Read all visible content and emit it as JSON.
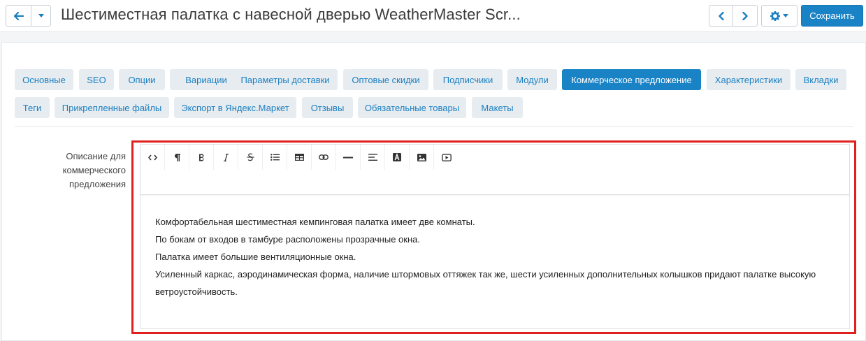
{
  "header": {
    "title": "Шестиместная палатка с навесной дверью WeatherMaster Scr...",
    "save_label": "Сохранить"
  },
  "tabs": [
    {
      "label": "Основные"
    },
    {
      "label": "SEO"
    },
    {
      "label": "Опции"
    },
    {
      "label": "Вариации"
    },
    {
      "label": "Параметры доставки"
    },
    {
      "label": "Оптовые скидки"
    },
    {
      "label": "Подписчики"
    },
    {
      "label": "Модули"
    },
    {
      "label": "Коммерческое предложение",
      "active": true
    },
    {
      "label": "Характеристики"
    },
    {
      "label": "Вкладки"
    },
    {
      "label": "Теги"
    },
    {
      "label": "Прикрепленные файлы"
    },
    {
      "label": "Экспорт в Яндекс.Маркет"
    },
    {
      "label": "Отзывы"
    },
    {
      "label": "Обязательные товары"
    },
    {
      "label": "Макеты"
    }
  ],
  "field": {
    "label": "Описание для коммерческого предложения"
  },
  "toolbar_icons": [
    "code-view-icon",
    "paragraph-icon",
    "bold-icon",
    "italic-icon",
    "strikethrough-icon",
    "unordered-list-icon",
    "table-icon",
    "link-icon",
    "horizontal-rule-icon",
    "align-left-icon",
    "text-color-icon",
    "image-icon",
    "video-icon"
  ],
  "editor": {
    "paragraphs": [
      "Комфортабельная шестиместная кемпинговая палатка имеет две комнаты.",
      "По бокам от входов в тамбуре расположены прозрачные окна.",
      "Палатка имеет большие вентиляционные окна.",
      "Усиленный каркас, аэродинамическая форма, наличие штормовых оттяжек так же, шести усиленных дополнительных колышков придают палатке высокую ветроустойчивость."
    ]
  },
  "colors": {
    "accent": "#1a83c6",
    "highlight": "#e0201f",
    "tab_bg": "#e7ecf0"
  }
}
